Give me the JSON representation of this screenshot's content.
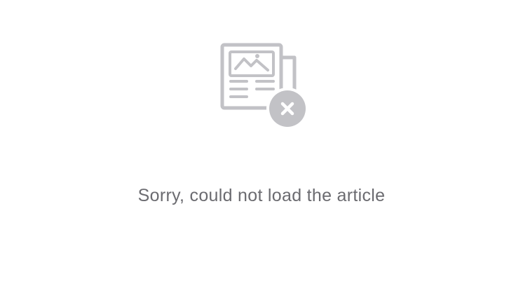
{
  "error": {
    "icon": "broken-article-icon",
    "badge_icon": "close-icon",
    "message": "Sorry, could not load the article"
  },
  "colors": {
    "background": "#ffffff",
    "icon_gray": "#c2c2c6",
    "text_gray": "#6b6b70"
  }
}
